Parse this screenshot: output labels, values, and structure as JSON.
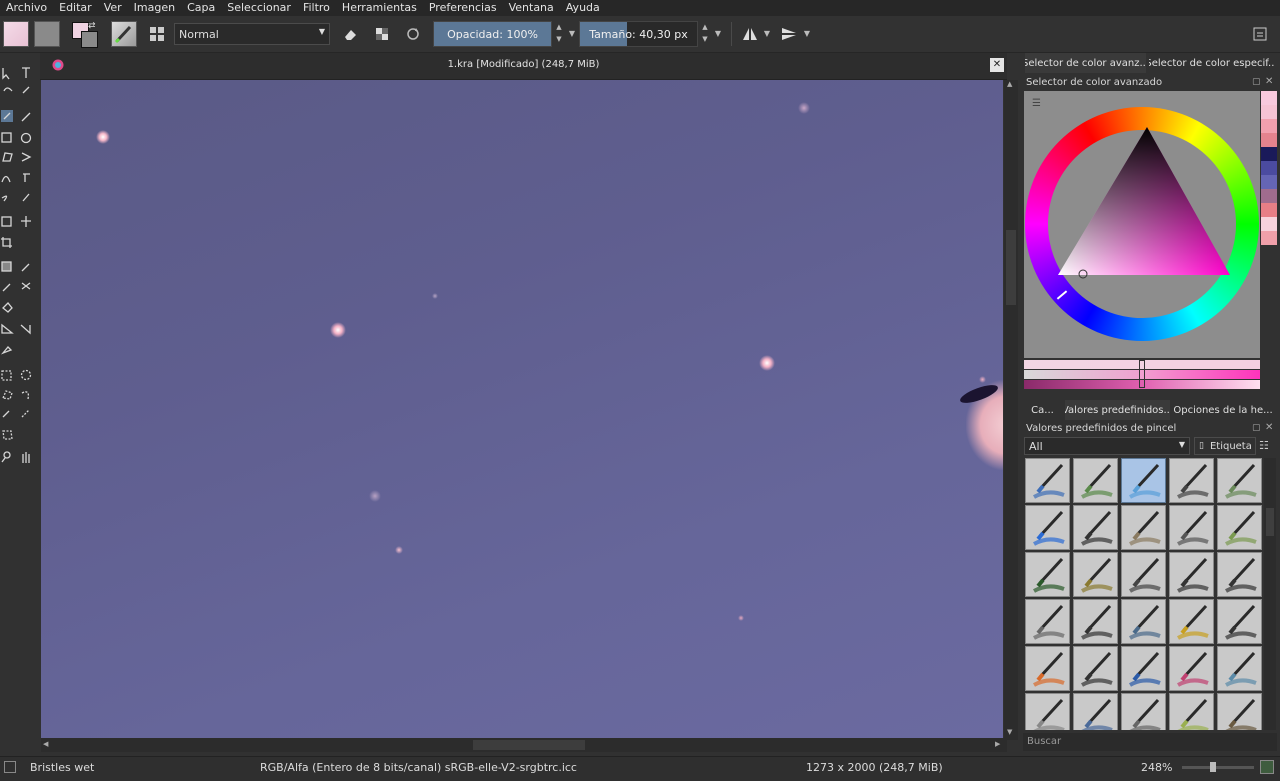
{
  "menu": [
    "Archivo",
    "Editar",
    "Ver",
    "Imagen",
    "Capa",
    "Seleccionar",
    "Filtro",
    "Herramientas",
    "Preferencias",
    "Ventana",
    "Ayuda"
  ],
  "toolbar": {
    "blend_mode": "Normal",
    "opacity_label": "Opacidad:",
    "opacity_value": "100%",
    "opacity_fraction": 1.0,
    "size_label": "Tamaño:",
    "size_value": "40,30 px",
    "size_fraction": 0.4
  },
  "colors": {
    "foreground": "#f0d3e2",
    "background": "#8a8a8a",
    "accent": "#5c7896"
  },
  "document": {
    "title": "1.kra [Modificado]  (248,7 MiB)"
  },
  "dockers": {
    "top_tabs": [
      "Selector de color avanz...",
      "Selector de color especif..."
    ],
    "color_selector_title": "Selector de color avanzado",
    "recent_colors": [
      "#f8c9dd",
      "#f6c3d4",
      "#f2a0ae",
      "#e5838e",
      "#1a1a5a",
      "#4b4ba0",
      "#6565b5",
      "#a06c8e",
      "#e77e86",
      "#f7d2dc",
      "#f0a0aa"
    ],
    "bottom_tabs": [
      "Ca...",
      "Valores predefinidos...",
      "Opciones de la he..."
    ],
    "presets_title": "Valores predefinidos de pincel",
    "filter_value": "All",
    "tag_label": "Etiqueta",
    "search_placeholder": "Buscar"
  },
  "status": {
    "brush_name": "Bristles wet",
    "color_space": "RGB/Alfa (Entero de 8 bits/canal)  sRGB-elle-V2-srgbtrc.icc",
    "dimensions": "1273 x 2000 (248,7 MiB)",
    "zoom": "248%"
  }
}
